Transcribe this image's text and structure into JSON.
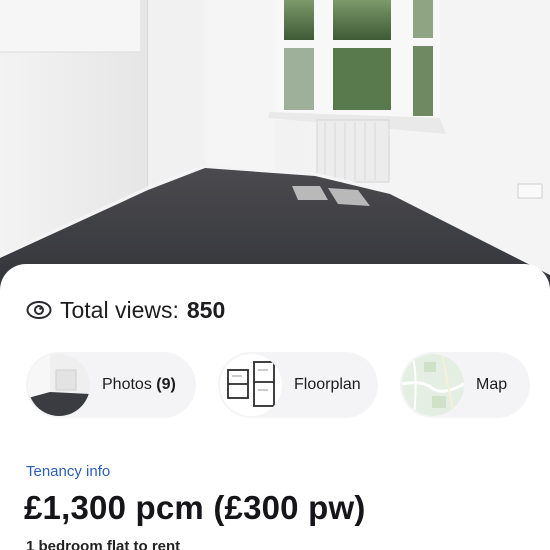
{
  "listing": {
    "views_label": "Total views:",
    "views_count": "850",
    "tenancy_label": "Tenancy info",
    "price": "£1,300 pcm (£300 pw)",
    "subtitle": "1 bedroom flat to rent"
  },
  "chips": {
    "photos_label": "Photos",
    "photos_count": "(9)",
    "floorplan_label": "Floorplan",
    "map_label": "Map"
  },
  "icons": {
    "views": "eye-icon",
    "floorplan": "floorplan-thumbnail",
    "map": "map-thumbnail"
  },
  "colors": {
    "link_blue": "#2a5fb8",
    "chip_bg": "#f4f4f6",
    "text_dark": "#16161a"
  }
}
